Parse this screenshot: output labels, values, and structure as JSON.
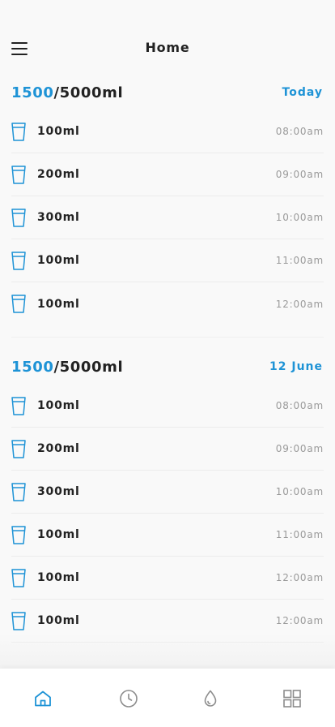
{
  "header": {
    "title": "Home"
  },
  "sections": [
    {
      "current": "1500",
      "goal": "/5000ml",
      "date": "Today",
      "entries": [
        {
          "amount": "100ml",
          "time": "08:00am"
        },
        {
          "amount": "200ml",
          "time": "09:00am"
        },
        {
          "amount": "300ml",
          "time": "10:00am"
        },
        {
          "amount": "100ml",
          "time": "11:00am"
        },
        {
          "amount": "100ml",
          "time": "12:00am"
        }
      ]
    },
    {
      "current": "1500",
      "goal": "/5000ml",
      "date": "12 June",
      "entries": [
        {
          "amount": "100ml",
          "time": "08:00am"
        },
        {
          "amount": "200ml",
          "time": "09:00am"
        },
        {
          "amount": "300ml",
          "time": "10:00am"
        },
        {
          "amount": "100ml",
          "time": "11:00am"
        },
        {
          "amount": "100ml",
          "time": "12:00am"
        },
        {
          "amount": "100ml",
          "time": "12:00am"
        }
      ]
    }
  ],
  "tabbar": {
    "tabs": [
      {
        "icon": "home-icon",
        "active": true
      },
      {
        "icon": "clock-icon",
        "active": false
      },
      {
        "icon": "water-drop-icon",
        "active": false
      },
      {
        "icon": "grid-icon",
        "active": false
      }
    ]
  },
  "colors": {
    "accent": "#1e93d6",
    "text": "#222222",
    "muted": "#9a9a9a",
    "background": "#f9f9f9"
  }
}
